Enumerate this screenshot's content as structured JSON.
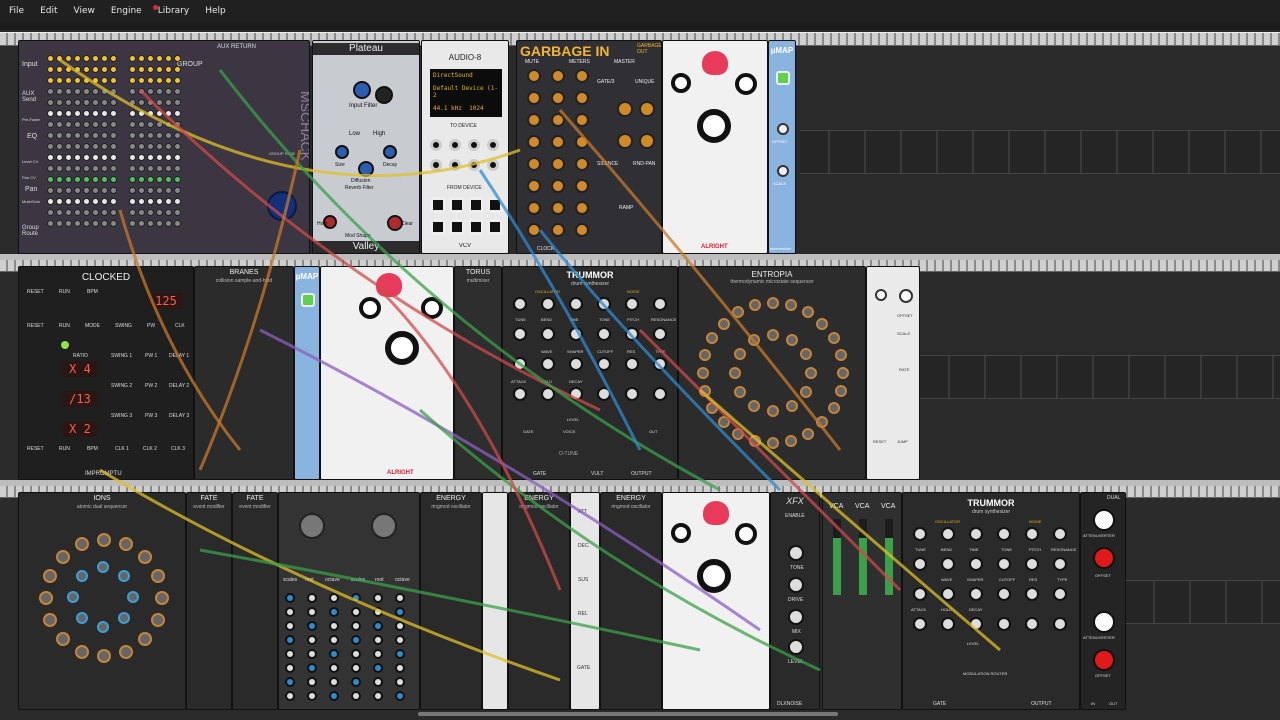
{
  "menu": {
    "items": [
      {
        "label": "File"
      },
      {
        "label": "Edit"
      },
      {
        "label": "View"
      },
      {
        "label": "Engine"
      },
      {
        "label": "Library",
        "has_notification": true
      }
    ],
    "help_label": "Help",
    "notification_color": "#e0283c"
  },
  "row1": {
    "mixer": {
      "labels": [
        "Input",
        "AUX Send",
        "Pre-Fader",
        "EQ",
        "Level CV",
        "Pan CV",
        "Pan",
        "Mute/Solo",
        "Group Route"
      ],
      "group": "GROUP",
      "aux_return": "AUX RETURN",
      "group_fade": "GROUP FADE",
      "brand": "MSCHACK"
    },
    "plateau": {
      "title": "Plateau",
      "footer": "Valley",
      "labels": [
        "L In",
        "R In",
        "Pre Delay",
        "Dry",
        "Wet",
        "L Out",
        "R Out",
        "Input Filter",
        "Size",
        "Decay",
        "Low",
        "High",
        "Tuned Mode",
        "Diffuse Input",
        "Diffusion",
        "Reverb Filter",
        "Hold",
        "Clear",
        "Mod Rate",
        "Mod Shape",
        "Mod Depth",
        "Freeze",
        "Tog"
      ]
    },
    "audio8": {
      "title": "AUDIO-8",
      "driver": "DirectSound",
      "device": "Default Device (1-2",
      "rate": "44.1 kHz",
      "block": "1024",
      "to_device": "TO DEVICE",
      "from_device": "FROM DEVICE",
      "footer": "VCV"
    },
    "garbage": {
      "title": "GARBAGE IN",
      "subtitle": "GARBAGE OUT",
      "labels": [
        "MUTE",
        "METERS",
        "MASTER",
        "GATE/3",
        "UNIQUE",
        "IN",
        "2-4",
        "SILENCE",
        "RND-PAN",
        "RAMP",
        "IN",
        "OUT"
      ],
      "footer": "CLOCK"
    },
    "chronoblob": {
      "title": "CHRONOBLOB",
      "brand": "ALRIGHT"
    },
    "umap1": {
      "title": "µMAP",
      "labels": [
        "IN",
        "OFFSET",
        "SCALE",
        "OUT"
      ],
      "footer": "stoermelder"
    }
  },
  "row2": {
    "clocked": {
      "title": "CLOCKED",
      "labels": [
        "RESET",
        "RUN",
        "BPM",
        "RESET",
        "RUN",
        "MODE",
        "SWING",
        "PW",
        "CLK",
        "RATIO",
        "SWING 1",
        "PW 1",
        "DELAY 1",
        "SWING 2",
        "PW 2",
        "DELAY 2",
        "SWING 3",
        "PW 3",
        "DELAY 3",
        "RESET",
        "RUN",
        "BPM",
        "CLK 1",
        "CLK 2",
        "CLK 3"
      ],
      "bpm": "125",
      "ratio1": "X 4",
      "ratio2": "/13",
      "ratio3": "X 2",
      "brand": "IMPROMPTU"
    },
    "branes": {
      "title": "BRANES",
      "subtitle": "collision sample-and-hold"
    },
    "umap2": {
      "title": "µMAP"
    },
    "chronoblob2": {
      "title": "CHRONOBLOB",
      "brand": "ALRIGHT"
    },
    "torus": {
      "title": "TORUS",
      "subtitle": "multimixer"
    },
    "trummor1": {
      "title": "TRUMMOR",
      "subtitle": "drum synthesizer",
      "labels": [
        "OSCILLATOR",
        "NOISE",
        "TUNE",
        "BEND",
        "TIME",
        "TONE",
        "PITCH",
        "RESONANCE",
        "WAVE",
        "SHAPER",
        "CUTOFF",
        "RES",
        "TYPE",
        "ATTACK",
        "HOLD",
        "DECAY",
        "LEVEL",
        "GATE",
        "VOICE",
        "OUT"
      ],
      "trig": "O-TUNE",
      "footer_gate": "GATE",
      "footer_vult": "VULT",
      "footer_out": "OUTPUT"
    },
    "entropia": {
      "title": "ENTROPIA",
      "subtitle": "thermodynamic microstate sequencer"
    },
    "small_panel": {
      "labels": [
        "IN",
        "SLEW",
        "OFFSET",
        "SCALE",
        "RATE",
        "BCON",
        "SLEW",
        "SCALE",
        "RESET",
        "JUMP",
        "GATE",
        "OUT"
      ]
    }
  },
  "row3": {
    "ions": {
      "title": "IONS",
      "subtitle": "atomic dual sequencer"
    },
    "fate1": {
      "title": "FATE",
      "subtitle": "event modifier"
    },
    "fate2": {
      "title": "FATE",
      "subtitle": "event modifier"
    },
    "quantizer": {
      "labels": [
        "scales",
        "root",
        "octave",
        "scales",
        "root",
        "octave"
      ]
    },
    "energy1": {
      "title": "ENERGY",
      "subtitle": "ringmod oscillator"
    },
    "energy2": {
      "title": "ENERGY",
      "subtitle": "ringmod oscillator"
    },
    "energy3": {
      "title": "ENERGY",
      "subtitle": "ringmod oscillator"
    },
    "adsr": {
      "labels": [
        "ATT",
        "DEC",
        "SUS",
        "REL",
        "TRIG",
        "GATE"
      ]
    },
    "chronoblob3": {
      "title": "CHRONOBLOB"
    },
    "xfx": {
      "title": "XFX",
      "labels": [
        "ENABLE",
        "TONE",
        "DRIVE",
        "MIX",
        "LEVEL"
      ],
      "footer": "DLXNOISE"
    },
    "vca": {
      "titles": [
        "VCA",
        "VCA",
        "VCA"
      ],
      "labels": [
        "CV",
        "EXP",
        "LIN",
        "IN",
        "OUT"
      ]
    },
    "trummor2": {
      "title": "TRUMMOR",
      "subtitle": "drum synthesizer",
      "labels": [
        "OSCILLATOR",
        "NOISE",
        "TUNE",
        "BEND",
        "TIME",
        "TONE",
        "PITCH",
        "RESONANCE",
        "WAVE",
        "SHAPER",
        "CUTOFF",
        "RES",
        "TYPE",
        "ATTACK",
        "HOLD",
        "DECAY",
        "LEVEL",
        "MODULATION ROUTER",
        "GATE",
        "OUTPUT"
      ]
    },
    "atten": {
      "title": "DUAL",
      "labels": [
        "ATTENUVERTER",
        "OFFSET",
        "ATTENUVERTER",
        "OFFSET",
        "IN",
        "OUT"
      ]
    }
  }
}
